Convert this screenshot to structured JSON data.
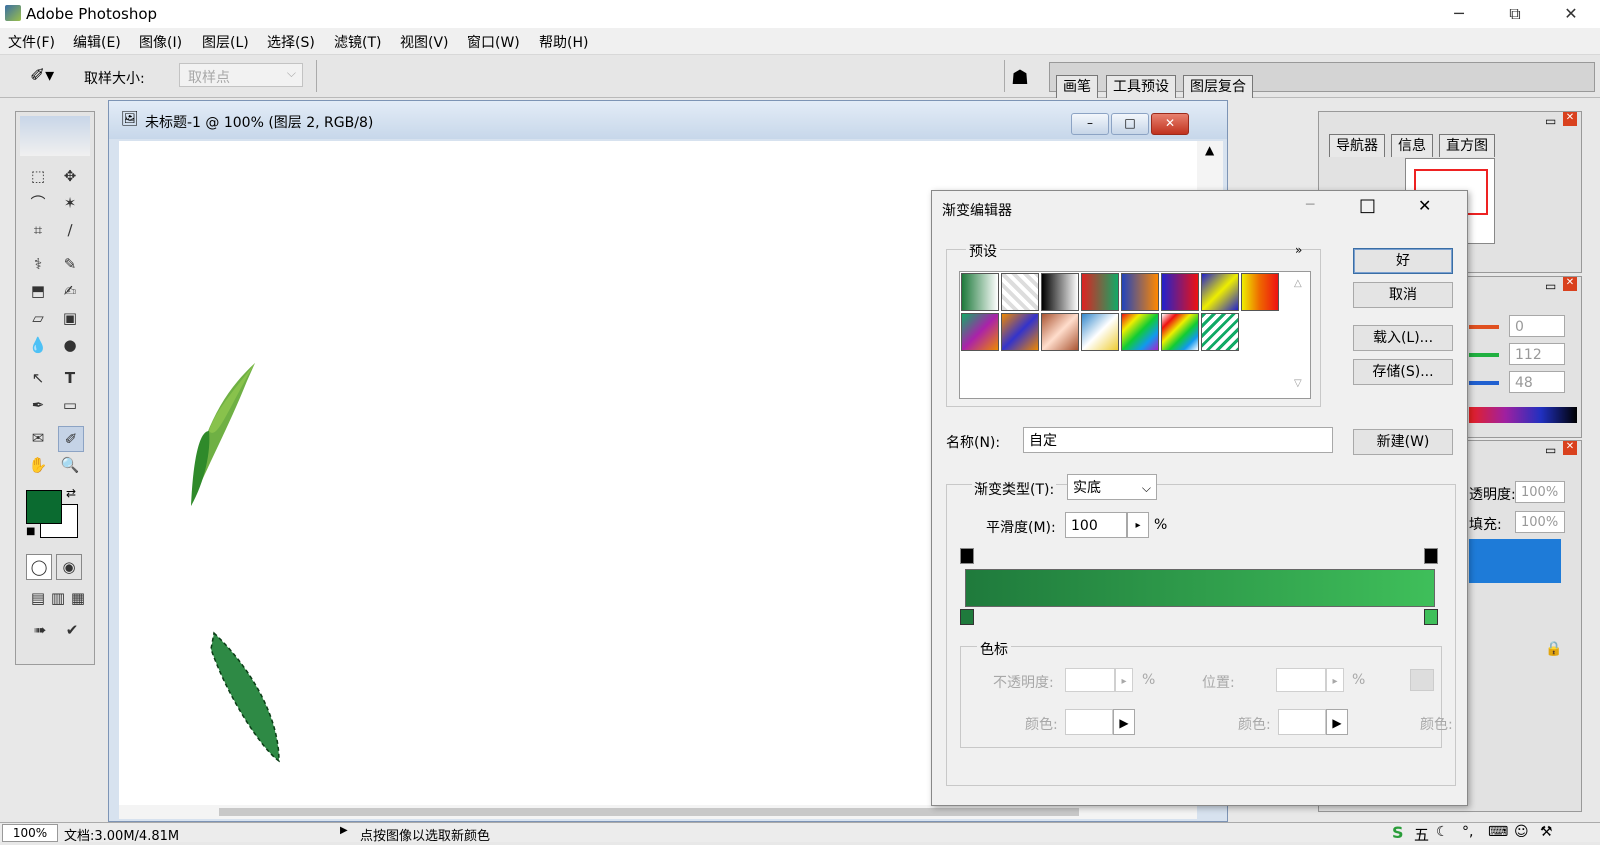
{
  "app": {
    "title": "Adobe Photoshop"
  },
  "menu": [
    "文件(F)",
    "编辑(E)",
    "图像(I)",
    "图层(L)",
    "选择(S)",
    "滤镜(T)",
    "视图(V)",
    "窗口(W)",
    "帮助(H)"
  ],
  "options": {
    "sample_size_label": "取样大小:",
    "sample_size_value": "取样点"
  },
  "palette_well_tabs": [
    "画笔",
    "工具预设",
    "图层复合"
  ],
  "document": {
    "title": "未标题-1 @ 100% (图层 2, RGB/8)"
  },
  "navigator_tabs": [
    "导航器",
    "信息",
    "直方图"
  ],
  "color_panel": {
    "values": [
      "0",
      "112",
      "48"
    ]
  },
  "layers_panel": {
    "opacity_label": "透明度:",
    "opacity_value": "100%",
    "fill_label": "填充:",
    "fill_value": "100%"
  },
  "gradient_editor": {
    "title": "渐变编辑器",
    "presets_label": "预设",
    "ok": "好",
    "cancel": "取消",
    "load": "载入(L)...",
    "save": "存储(S)...",
    "name_label": "名称(N):",
    "name_value": "自定",
    "new": "新建(W)",
    "type_label": "渐变类型(T):",
    "type_value": "实底",
    "smooth_label": "平滑度(M):",
    "smooth_value": "100",
    "percent": "%",
    "stops_label": "色标",
    "opacity_label": "不透明度:",
    "location_label": "位置:",
    "color_label": "颜色:",
    "gradient_start": "#1f7a3c",
    "gradient_end": "#3fbf5a"
  },
  "status": {
    "zoom": "100%",
    "doc_info": "文档:3.00M/4.81M",
    "hint": "点按图像以选取新颜色"
  },
  "taskbar": {
    "ime": "五"
  },
  "colors": {
    "foreground": "#0b6b30",
    "accent_blue": "#1e7bd8"
  }
}
